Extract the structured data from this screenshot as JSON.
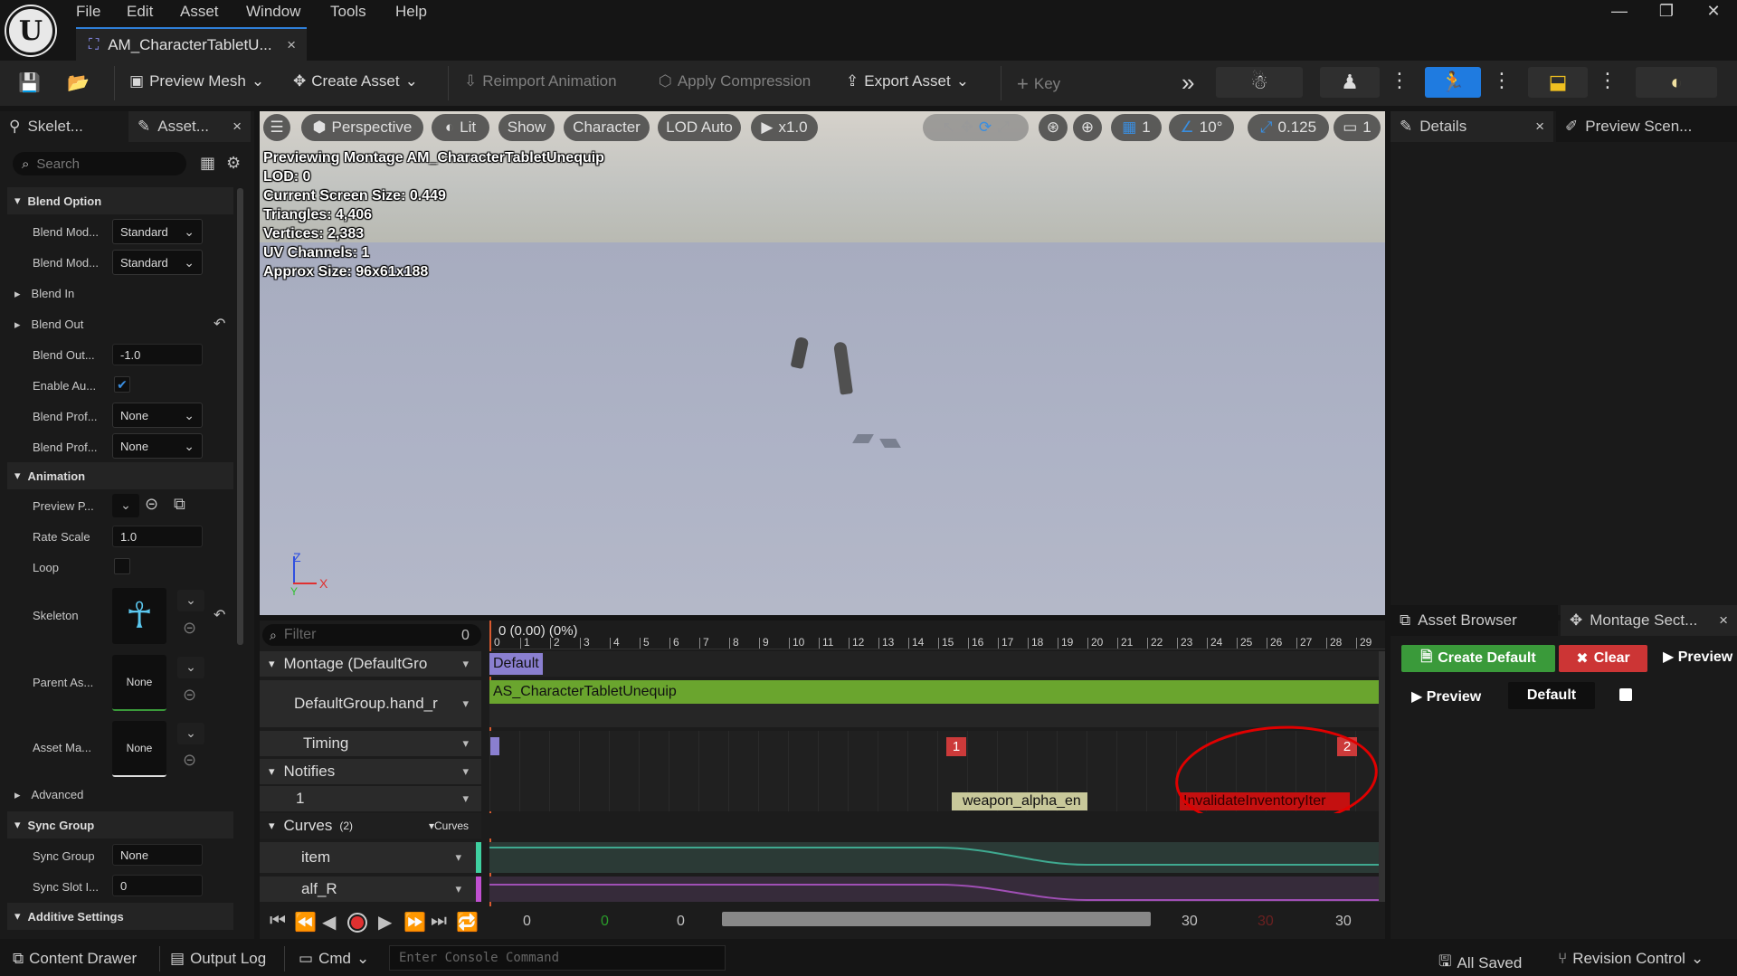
{
  "menu": [
    "File",
    "Edit",
    "Asset",
    "Window",
    "Tools",
    "Help"
  ],
  "window": {
    "minimize": "—",
    "restore": "❐",
    "close": "✕"
  },
  "document_tab": {
    "title": "AM_CharacterTabletU...",
    "close": "×"
  },
  "toolbar": {
    "preview_mesh": "Preview Mesh",
    "create_asset": "Create Asset",
    "reimport_animation": "Reimport Animation",
    "apply_compression": "Apply Compression",
    "export_asset": "Export Asset",
    "key": "Key"
  },
  "left_panel": {
    "tabs": [
      "Skelet...",
      "Asset..."
    ],
    "search_placeholder": "Search",
    "sections": {
      "blend_option": "Blend Option",
      "animation": "Animation",
      "advanced": "Advanced",
      "sync_group": "Sync Group",
      "additive_settings": "Additive Settings"
    },
    "rows": {
      "blend_mode_in": {
        "label": "Blend Mod...",
        "value": "Standard"
      },
      "blend_mode_out": {
        "label": "Blend Mod...",
        "value": "Standard"
      },
      "blend_in": {
        "label": "Blend In"
      },
      "blend_out": {
        "label": "Blend Out"
      },
      "blend_out_trigger": {
        "label": "Blend Out...",
        "value": "-1.0"
      },
      "enable_auto": {
        "label": "Enable Au...",
        "checked": true
      },
      "blend_profile_in": {
        "label": "Blend Prof...",
        "value": "None"
      },
      "blend_profile_out": {
        "label": "Blend Prof...",
        "value": "None"
      },
      "preview_pose": {
        "label": "Preview P..."
      },
      "rate_scale": {
        "label": "Rate Scale",
        "value": "1.0"
      },
      "loop": {
        "label": "Loop",
        "checked": false
      },
      "skeleton": {
        "label": "Skeleton"
      },
      "parent_asset": {
        "label": "Parent As...",
        "value": "None"
      },
      "asset_mapping": {
        "label": "Asset Ma...",
        "value": "None"
      },
      "sync_group": {
        "label": "Sync Group",
        "value": "None"
      },
      "sync_slot": {
        "label": "Sync Slot I...",
        "value": "0"
      }
    }
  },
  "viewport": {
    "buttons": {
      "perspective": "Perspective",
      "lit": "Lit",
      "show": "Show",
      "character": "Character",
      "lod": "LOD Auto",
      "speed": "x1.0"
    },
    "right_controls": {
      "grid": "1",
      "angle": "10°",
      "scale": "0.125",
      "camera": "1"
    },
    "stats": [
      "Previewing Montage AM_CharacterTabletUnequip",
      "LOD: 0",
      "Current Screen Size: 0.449",
      "Triangles: 4,406",
      "Vertices: 2,383",
      "UV Channels: 1",
      "Approx Size: 96x61x188"
    ],
    "axis": {
      "z": "Z",
      "x": "X",
      "y": "Y"
    }
  },
  "sequencer": {
    "filter_placeholder": "Filter",
    "filter_count": "0",
    "time_display": "0 (0.00) (0%)",
    "ticks": [
      "0",
      "1",
      "2",
      "3",
      "4",
      "5",
      "6",
      "7",
      "8",
      "9",
      "10",
      "11",
      "12",
      "13",
      "14",
      "15",
      "16",
      "17",
      "18",
      "19",
      "20",
      "21",
      "22",
      "23",
      "24",
      "25",
      "26",
      "27",
      "28",
      "29"
    ],
    "tracks": {
      "montage": "Montage (DefaultGro",
      "slot": "DefaultGroup.hand_r",
      "timing": "Timing",
      "notifies": "Notifies",
      "notify_track": "1",
      "curves": "Curves",
      "curves_count": "(2)",
      "curves_button": "Curves",
      "curve1": "item",
      "curve2": "alf_R"
    },
    "section_label": "Default",
    "clip_label": "AS_CharacterTabletUnequip",
    "timing_markers": [
      "1",
      "2"
    ],
    "notifies": [
      "weapon_alpha_en",
      "InvalidateInventoryIter"
    ],
    "transport": {
      "start": "0",
      "current": "0",
      "end_left": "0",
      "end1": "30",
      "end2": "30",
      "end3": "30"
    }
  },
  "right_panel": {
    "tabs": [
      "Details",
      "Preview Scen..."
    ],
    "bottom_tabs": [
      "Asset Browser",
      "Montage Sect..."
    ],
    "create_default": "Create Default",
    "clear": "Clear",
    "preview_all": "Preview",
    "preview": "Preview",
    "default": "Default"
  },
  "statusbar": {
    "content_drawer": "Content Drawer",
    "output_log": "Output Log",
    "cmd": "Cmd",
    "console_placeholder": "Enter Console Command",
    "all_saved": "All Saved",
    "revision_control": "Revision Control"
  },
  "colors": {
    "accent_blue": "#2f7fd8",
    "clip_green": "#6aa52e",
    "curve_teal": "#3fa990",
    "curve_purple": "#a04fb5",
    "marker_red": "#cc3a3a",
    "annotation_red": "#e00000"
  }
}
